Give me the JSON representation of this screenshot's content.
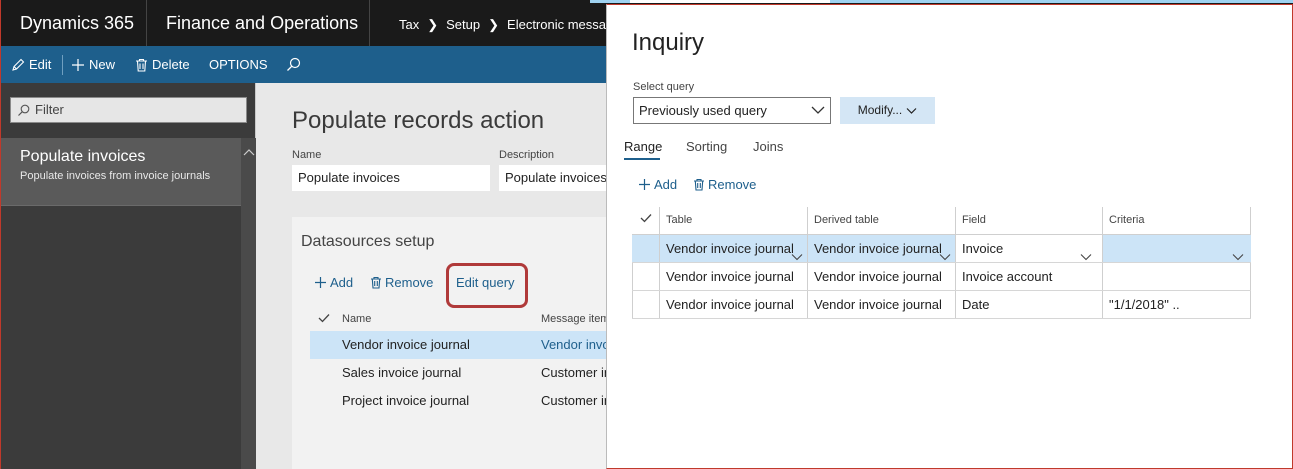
{
  "header": {
    "brand": "Dynamics 365",
    "app_name": "Finance and Operations",
    "breadcrumbs": [
      "Tax",
      "Setup",
      "Electronic messag"
    ]
  },
  "toolbar": {
    "edit_label": "Edit",
    "new_label": "New",
    "delete_label": "Delete",
    "options_label": "OPTIONS"
  },
  "sidebar": {
    "filter_placeholder": "Filter",
    "items": [
      {
        "title": "Populate invoices",
        "subtitle": "Populate invoices from invoice journals"
      }
    ]
  },
  "main": {
    "title": "Populate records action",
    "name_label": "Name",
    "name_value": "Populate invoices",
    "description_label": "Description",
    "description_value": "Populate invoices",
    "datasources": {
      "title": "Datasources setup",
      "add_label": "Add",
      "remove_label": "Remove",
      "edit_query_label": "Edit query",
      "columns": [
        "Name",
        "Message item"
      ],
      "rows": [
        {
          "name": "Vendor invoice journal",
          "message_item": "Vendor invo"
        },
        {
          "name": "Sales invoice journal",
          "message_item": "Customer in"
        },
        {
          "name": "Project invoice journal",
          "message_item": "Customer in"
        }
      ]
    }
  },
  "dialog": {
    "title": "Inquiry",
    "select_query_label": "Select query",
    "select_query_value": "Previously used query",
    "modify_label": "Modify...",
    "tabs": [
      "Range",
      "Sorting",
      "Joins"
    ],
    "active_tab": "Range",
    "add_label": "Add",
    "remove_label": "Remove",
    "columns": [
      "Table",
      "Derived table",
      "Field",
      "Criteria"
    ],
    "rows": [
      {
        "table": "Vendor invoice journal",
        "derived_table": "Vendor invoice journal",
        "field": "Invoice",
        "criteria": ""
      },
      {
        "table": "Vendor invoice journal",
        "derived_table": "Vendor invoice journal",
        "field": "Invoice account",
        "criteria": ""
      },
      {
        "table": "Vendor invoice journal",
        "derived_table": "Vendor invoice journal",
        "field": "Date",
        "criteria": "\"1/1/2018\" .."
      }
    ]
  },
  "colors": {
    "topbar": "#1a1a1a",
    "actionbar": "#1e5f8c",
    "selection": "#cce4f7",
    "highlight_ring": "#b03a3a"
  }
}
